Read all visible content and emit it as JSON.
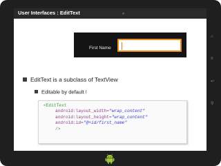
{
  "slide": {
    "title": "User Interfaces : EditText"
  },
  "demo": {
    "label": "First Name",
    "input_value": ""
  },
  "bullets": [
    {
      "text": "EditText is a subclass of TextView"
    },
    {
      "text": "Editable by default !"
    }
  ],
  "code": {
    "tag_open": "<EditText",
    "attr1_name": "android:layout_width=",
    "attr1_value": "\"wrap_content\"",
    "attr2_name": "android:layout_height=",
    "attr2_value": "\"wrap_content\"",
    "attr3_name": "android:id=",
    "attr3_value": "\"@+id/first_name\"",
    "tag_close": "/>"
  },
  "colors": {
    "focus_border": "#f08c1e",
    "xml_tag": "#3b9b3b",
    "xml_attribute": "#8b3e8b",
    "xml_value": "#3a3acd",
    "android_green": "#a4c639"
  },
  "device": {
    "icons": [
      "android-logo-icon",
      "home-icon",
      "menu-icon",
      "back-icon",
      "search-icon"
    ]
  }
}
